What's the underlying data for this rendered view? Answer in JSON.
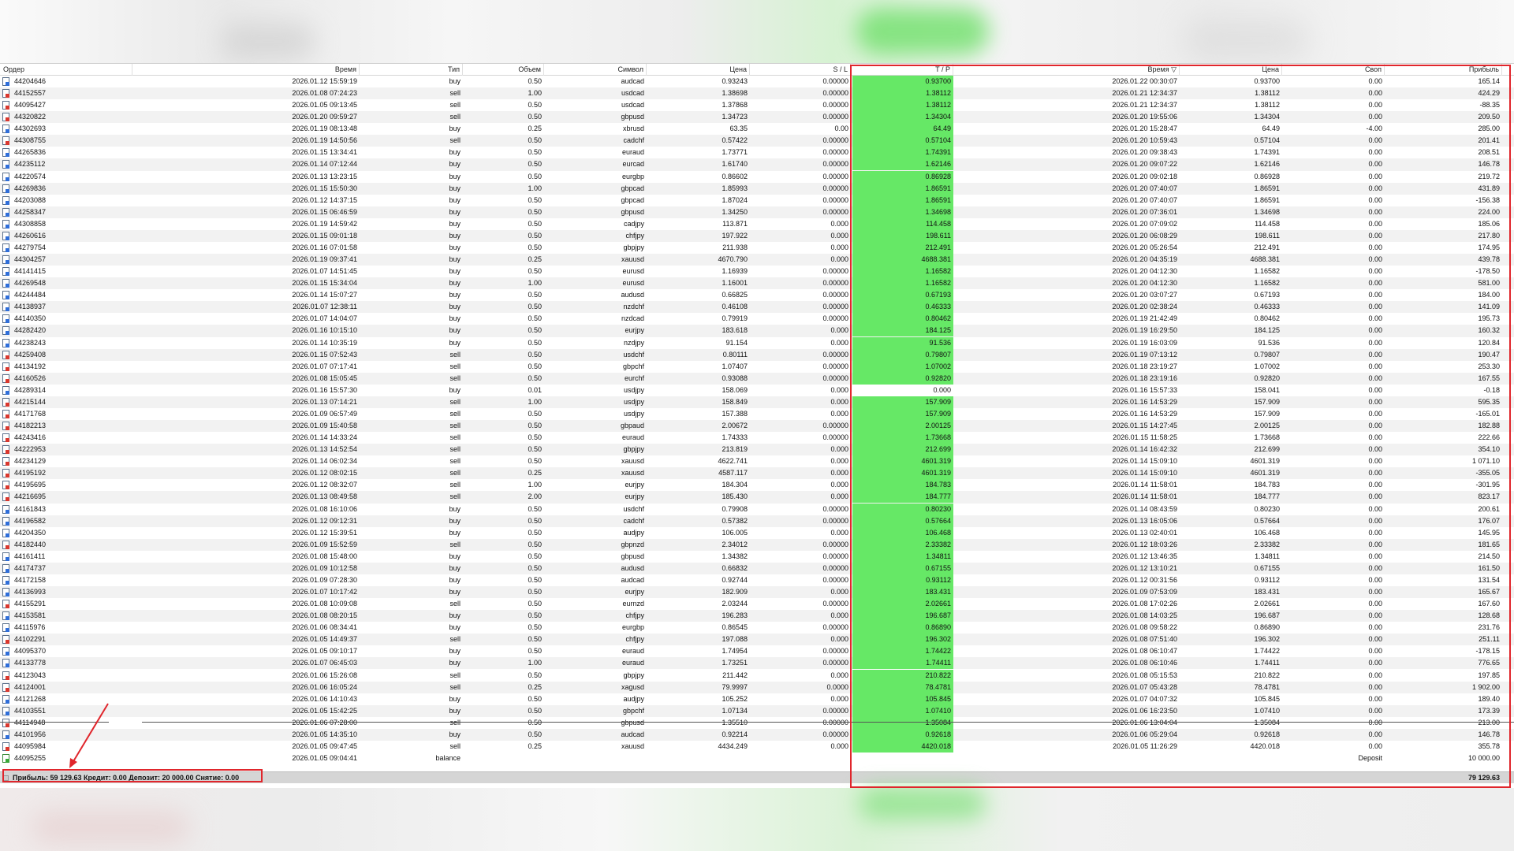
{
  "columns": {
    "order": "Ордер",
    "time": "Время",
    "type": "Тип",
    "volume": "Объем",
    "symbol": "Символ",
    "price": "Цена",
    "sl": "S / L",
    "tp": "T / P",
    "close_time": "Время ▽",
    "close_price": "Цена",
    "swap": "Своп",
    "profit": "Прибыль"
  },
  "rows": [
    [
      "44204646",
      "2026.01.12 15:59:19",
      "buy",
      "0.50",
      "audcad",
      "0.93243",
      "0.00000",
      "0.93700",
      "2026.01.22 00:30:07",
      "0.93700",
      "0.00",
      "165.14"
    ],
    [
      "44152557",
      "2026.01.08 07:24:23",
      "sell",
      "1.00",
      "usdcad",
      "1.38698",
      "0.00000",
      "1.38112",
      "2026.01.21 12:34:37",
      "1.38112",
      "0.00",
      "424.29"
    ],
    [
      "44095427",
      "2026.01.05 09:13:45",
      "sell",
      "0.50",
      "usdcad",
      "1.37868",
      "0.00000",
      "1.38112",
      "2026.01.21 12:34:37",
      "1.38112",
      "0.00",
      "-88.35"
    ],
    [
      "44320822",
      "2026.01.20 09:59:27",
      "sell",
      "0.50",
      "gbpusd",
      "1.34723",
      "0.00000",
      "1.34304",
      "2026.01.20 19:55:06",
      "1.34304",
      "0.00",
      "209.50"
    ],
    [
      "44302693",
      "2026.01.19 08:13:48",
      "buy",
      "0.25",
      "xbrusd",
      "63.35",
      "0.00",
      "64.49",
      "2026.01.20 15:28:47",
      "64.49",
      "-4.00",
      "285.00"
    ],
    [
      "44308755",
      "2026.01.19 14:50:56",
      "sell",
      "0.50",
      "cadchf",
      "0.57422",
      "0.00000",
      "0.57104",
      "2026.01.20 10:59:43",
      "0.57104",
      "0.00",
      "201.41"
    ],
    [
      "44265836",
      "2026.01.15 13:34:41",
      "buy",
      "0.50",
      "euraud",
      "1.73771",
      "0.00000",
      "1.74391",
      "2026.01.20 09:38:43",
      "1.74391",
      "0.00",
      "208.51"
    ],
    [
      "44235112",
      "2026.01.14 07:12:44",
      "buy",
      "0.50",
      "eurcad",
      "1.61740",
      "0.00000",
      "1.62146",
      "2026.01.20 09:07:22",
      "1.62146",
      "0.00",
      "146.78"
    ],
    [
      "44220574",
      "2026.01.13 13:23:15",
      "buy",
      "0.50",
      "eurgbp",
      "0.86602",
      "0.00000",
      "0.86928",
      "2026.01.20 09:02:18",
      "0.86928",
      "0.00",
      "219.72"
    ],
    [
      "44269836",
      "2026.01.15 15:50:30",
      "buy",
      "1.00",
      "gbpcad",
      "1.85993",
      "0.00000",
      "1.86591",
      "2026.01.20 07:40:07",
      "1.86591",
      "0.00",
      "431.89"
    ],
    [
      "44203088",
      "2026.01.12 14:37:15",
      "buy",
      "0.50",
      "gbpcad",
      "1.87024",
      "0.00000",
      "1.86591",
      "2026.01.20 07:40:07",
      "1.86591",
      "0.00",
      "-156.38"
    ],
    [
      "44258347",
      "2026.01.15 06:46:59",
      "buy",
      "0.50",
      "gbpusd",
      "1.34250",
      "0.00000",
      "1.34698",
      "2026.01.20 07:36:01",
      "1.34698",
      "0.00",
      "224.00"
    ],
    [
      "44308858",
      "2026.01.19 14:59:42",
      "buy",
      "0.50",
      "cadjpy",
      "113.871",
      "0.000",
      "114.458",
      "2026.01.20 07:09:02",
      "114.458",
      "0.00",
      "185.06"
    ],
    [
      "44260616",
      "2026.01.15 09:01:18",
      "buy",
      "0.50",
      "chfjpy",
      "197.922",
      "0.000",
      "198.611",
      "2026.01.20 06:08:29",
      "198.611",
      "0.00",
      "217.80"
    ],
    [
      "44279754",
      "2026.01.16 07:01:58",
      "buy",
      "0.50",
      "gbpjpy",
      "211.938",
      "0.000",
      "212.491",
      "2026.01.20 05:26:54",
      "212.491",
      "0.00",
      "174.95"
    ],
    [
      "44304257",
      "2026.01.19 09:37:41",
      "buy",
      "0.25",
      "xauusd",
      "4670.790",
      "0.000",
      "4688.381",
      "2026.01.20 04:35:19",
      "4688.381",
      "0.00",
      "439.78"
    ],
    [
      "44141415",
      "2026.01.07 14:51:45",
      "buy",
      "0.50",
      "eurusd",
      "1.16939",
      "0.00000",
      "1.16582",
      "2026.01.20 04:12:30",
      "1.16582",
      "0.00",
      "-178.50"
    ],
    [
      "44269548",
      "2026.01.15 15:34:04",
      "buy",
      "1.00",
      "eurusd",
      "1.16001",
      "0.00000",
      "1.16582",
      "2026.01.20 04:12:30",
      "1.16582",
      "0.00",
      "581.00"
    ],
    [
      "44244484",
      "2026.01.14 15:07:27",
      "buy",
      "0.50",
      "audusd",
      "0.66825",
      "0.00000",
      "0.67193",
      "2026.01.20 03:07:27",
      "0.67193",
      "0.00",
      "184.00"
    ],
    [
      "44138937",
      "2026.01.07 12:38:11",
      "buy",
      "0.50",
      "nzdchf",
      "0.46108",
      "0.00000",
      "0.46333",
      "2026.01.20 02:38:24",
      "0.46333",
      "0.00",
      "141.09"
    ],
    [
      "44140350",
      "2026.01.07 14:04:07",
      "buy",
      "0.50",
      "nzdcad",
      "0.79919",
      "0.00000",
      "0.80462",
      "2026.01.19 21:42:49",
      "0.80462",
      "0.00",
      "195.73"
    ],
    [
      "44282420",
      "2026.01.16 10:15:10",
      "buy",
      "0.50",
      "eurjpy",
      "183.618",
      "0.000",
      "184.125",
      "2026.01.19 16:29:50",
      "184.125",
      "0.00",
      "160.32"
    ],
    [
      "44238243",
      "2026.01.14 10:35:19",
      "buy",
      "0.50",
      "nzdjpy",
      "91.154",
      "0.000",
      "91.536",
      "2026.01.19 16:03:09",
      "91.536",
      "0.00",
      "120.84"
    ],
    [
      "44259408",
      "2026.01.15 07:52:43",
      "sell",
      "0.50",
      "usdchf",
      "0.80111",
      "0.00000",
      "0.79807",
      "2026.01.19 07:13:12",
      "0.79807",
      "0.00",
      "190.47"
    ],
    [
      "44134192",
      "2026.01.07 07:17:41",
      "sell",
      "0.50",
      "gbpchf",
      "1.07407",
      "0.00000",
      "1.07002",
      "2026.01.18 23:19:27",
      "1.07002",
      "0.00",
      "253.30"
    ],
    [
      "44160526",
      "2026.01.08 15:05:45",
      "sell",
      "0.50",
      "eurchf",
      "0.93088",
      "0.00000",
      "0.92820",
      "2026.01.18 23:19:16",
      "0.92820",
      "0.00",
      "167.55"
    ],
    [
      "44289314",
      "2026.01.16 15:57:30",
      "buy",
      "0.01",
      "usdjpy",
      "158.069",
      "0.000",
      "0.000",
      "2026.01.16 15:57:33",
      "158.041",
      "0.00",
      "-0.18"
    ],
    [
      "44215144",
      "2026.01.13 07:14:21",
      "sell",
      "1.00",
      "usdjpy",
      "158.849",
      "0.000",
      "157.909",
      "2026.01.16 14:53:29",
      "157.909",
      "0.00",
      "595.35"
    ],
    [
      "44171768",
      "2026.01.09 06:57:49",
      "sell",
      "0.50",
      "usdjpy",
      "157.388",
      "0.000",
      "157.909",
      "2026.01.16 14:53:29",
      "157.909",
      "0.00",
      "-165.01"
    ],
    [
      "44182213",
      "2026.01.09 15:40:58",
      "sell",
      "0.50",
      "gbpaud",
      "2.00672",
      "0.00000",
      "2.00125",
      "2026.01.15 14:27:45",
      "2.00125",
      "0.00",
      "182.88"
    ],
    [
      "44243416",
      "2026.01.14 14:33:24",
      "sell",
      "0.50",
      "euraud",
      "1.74333",
      "0.00000",
      "1.73668",
      "2026.01.15 11:58:25",
      "1.73668",
      "0.00",
      "222.66"
    ],
    [
      "44222953",
      "2026.01.13 14:52:54",
      "sell",
      "0.50",
      "gbpjpy",
      "213.819",
      "0.000",
      "212.699",
      "2026.01.14 16:42:32",
      "212.699",
      "0.00",
      "354.10"
    ],
    [
      "44234129",
      "2026.01.14 06:02:34",
      "sell",
      "0.50",
      "xauusd",
      "4622.741",
      "0.000",
      "4601.319",
      "2026.01.14 15:09:10",
      "4601.319",
      "0.00",
      "1 071.10"
    ],
    [
      "44195192",
      "2026.01.12 08:02:15",
      "sell",
      "0.25",
      "xauusd",
      "4587.117",
      "0.000",
      "4601.319",
      "2026.01.14 15:09:10",
      "4601.319",
      "0.00",
      "-355.05"
    ],
    [
      "44195695",
      "2026.01.12 08:32:07",
      "sell",
      "1.00",
      "eurjpy",
      "184.304",
      "0.000",
      "184.783",
      "2026.01.14 11:58:01",
      "184.783",
      "0.00",
      "-301.95"
    ],
    [
      "44216695",
      "2026.01.13 08:49:58",
      "sell",
      "2.00",
      "eurjpy",
      "185.430",
      "0.000",
      "184.777",
      "2026.01.14 11:58:01",
      "184.777",
      "0.00",
      "823.17"
    ],
    [
      "44161843",
      "2026.01.08 16:10:06",
      "buy",
      "0.50",
      "usdchf",
      "0.79908",
      "0.00000",
      "0.80230",
      "2026.01.14 08:43:59",
      "0.80230",
      "0.00",
      "200.61"
    ],
    [
      "44196582",
      "2026.01.12 09:12:31",
      "buy",
      "0.50",
      "cadchf",
      "0.57382",
      "0.00000",
      "0.57664",
      "2026.01.13 16:05:06",
      "0.57664",
      "0.00",
      "176.07"
    ],
    [
      "44204350",
      "2026.01.12 15:39:51",
      "buy",
      "0.50",
      "audjpy",
      "106.005",
      "0.000",
      "106.468",
      "2026.01.13 02:40:01",
      "106.468",
      "0.00",
      "145.95"
    ],
    [
      "44182440",
      "2026.01.09 15:52:59",
      "sell",
      "0.50",
      "gbpnzd",
      "2.34012",
      "0.00000",
      "2.33382",
      "2026.01.12 18:03:26",
      "2.33382",
      "0.00",
      "181.65"
    ],
    [
      "44161411",
      "2026.01.08 15:48:00",
      "buy",
      "0.50",
      "gbpusd",
      "1.34382",
      "0.00000",
      "1.34811",
      "2026.01.12 13:46:35",
      "1.34811",
      "0.00",
      "214.50"
    ],
    [
      "44174737",
      "2026.01.09 10:12:58",
      "buy",
      "0.50",
      "audusd",
      "0.66832",
      "0.00000",
      "0.67155",
      "2026.01.12 13:10:21",
      "0.67155",
      "0.00",
      "161.50"
    ],
    [
      "44172158",
      "2026.01.09 07:28:30",
      "buy",
      "0.50",
      "audcad",
      "0.92744",
      "0.00000",
      "0.93112",
      "2026.01.12 00:31:56",
      "0.93112",
      "0.00",
      "131.54"
    ],
    [
      "44136993",
      "2026.01.07 10:17:42",
      "buy",
      "0.50",
      "eurjpy",
      "182.909",
      "0.000",
      "183.431",
      "2026.01.09 07:53:09",
      "183.431",
      "0.00",
      "165.67"
    ],
    [
      "44155291",
      "2026.01.08 10:09:08",
      "sell",
      "0.50",
      "eurnzd",
      "2.03244",
      "0.00000",
      "2.02661",
      "2026.01.08 17:02:26",
      "2.02661",
      "0.00",
      "167.60"
    ],
    [
      "44153581",
      "2026.01.08 08:20:15",
      "buy",
      "0.50",
      "chfjpy",
      "196.283",
      "0.000",
      "196.687",
      "2026.01.08 14:03:25",
      "196.687",
      "0.00",
      "128.68"
    ],
    [
      "44115976",
      "2026.01.06 08:34:41",
      "buy",
      "0.50",
      "eurgbp",
      "0.86545",
      "0.00000",
      "0.86890",
      "2026.01.08 09:58:22",
      "0.86890",
      "0.00",
      "231.76"
    ],
    [
      "44102291",
      "2026.01.05 14:49:37",
      "sell",
      "0.50",
      "chfjpy",
      "197.088",
      "0.000",
      "196.302",
      "2026.01.08 07:51:40",
      "196.302",
      "0.00",
      "251.11"
    ],
    [
      "44095370",
      "2026.01.05 09:10:17",
      "buy",
      "0.50",
      "euraud",
      "1.74954",
      "0.00000",
      "1.74422",
      "2026.01.08 06:10:47",
      "1.74422",
      "0.00",
      "-178.15"
    ],
    [
      "44133778",
      "2026.01.07 06:45:03",
      "buy",
      "1.00",
      "euraud",
      "1.73251",
      "0.00000",
      "1.74411",
      "2026.01.08 06:10:46",
      "1.74411",
      "0.00",
      "776.65"
    ],
    [
      "44123043",
      "2026.01.06 15:26:08",
      "sell",
      "0.50",
      "gbpjpy",
      "211.442",
      "0.000",
      "210.822",
      "2026.01.08 05:15:53",
      "210.822",
      "0.00",
      "197.85"
    ],
    [
      "44124001",
      "2026.01.06 16:05:24",
      "sell",
      "0.25",
      "xagusd",
      "79.9997",
      "0.0000",
      "78.4781",
      "2026.01.07 05:43:28",
      "78.4781",
      "0.00",
      "1 902.00"
    ],
    [
      "44121268",
      "2026.01.06 14:10:43",
      "buy",
      "0.50",
      "audjpy",
      "105.252",
      "0.000",
      "105.845",
      "2026.01.07 04:07:32",
      "105.845",
      "0.00",
      "189.40"
    ],
    [
      "44103551",
      "2026.01.05 15:42:25",
      "buy",
      "0.50",
      "gbpchf",
      "1.07134",
      "0.00000",
      "1.07410",
      "2026.01.06 16:23:50",
      "1.07410",
      "0.00",
      "173.39"
    ],
    [
      "44114948",
      "2026.01.06 07:28:00",
      "sell",
      "0.50",
      "gbpusd",
      "1.35510",
      "0.00000",
      "1.35084",
      "2026.01.06 13:04:04",
      "1.35084",
      "0.00",
      "213.00"
    ],
    [
      "44101956",
      "2026.01.05 14:35:10",
      "buy",
      "0.50",
      "audcad",
      "0.92214",
      "0.00000",
      "0.92618",
      "2026.01.06 05:29:04",
      "0.92618",
      "0.00",
      "146.78"
    ],
    [
      "44095984",
      "2026.01.05 09:47:45",
      "sell",
      "0.25",
      "xauusd",
      "4434.249",
      "0.000",
      "4420.018",
      "2026.01.05 11:26:29",
      "4420.018",
      "0.00",
      "355.78"
    ]
  ],
  "balance_row": {
    "order": "44095255",
    "time": "2026.01.05 09:04:41",
    "type": "balance",
    "comment": "Deposit",
    "profit": "10 000.00"
  },
  "summary": {
    "text": "Прибыль: 59 129.63  Кредит: 0.00  Депозит: 20 000.00  Снятие: 0.00",
    "total_profit": "79 129.63"
  },
  "colors": {
    "tp_highlight": "#66e866",
    "annotation": "#e0262c",
    "row_alt": "#f2f2f2"
  }
}
